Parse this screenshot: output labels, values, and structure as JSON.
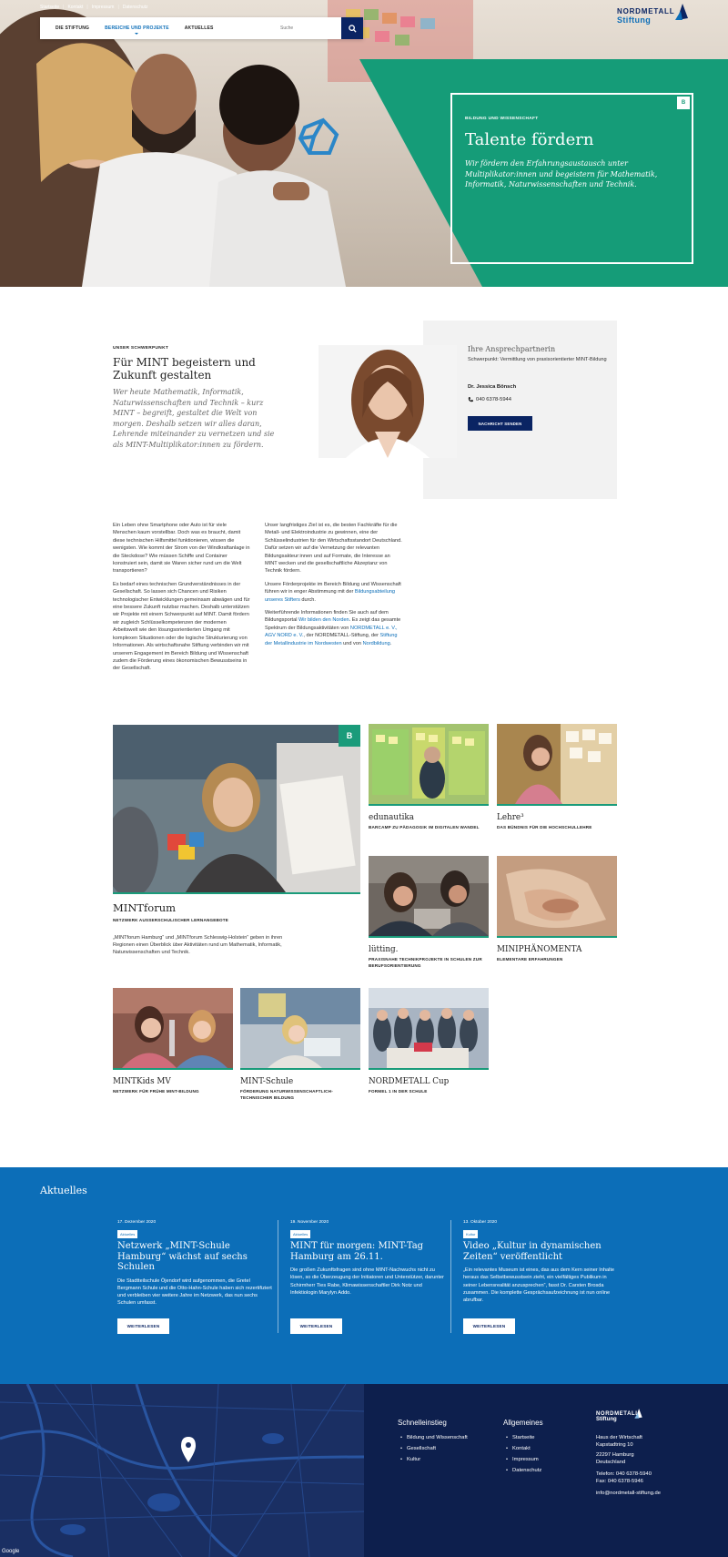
{
  "topmeta": {
    "items": [
      "Startseite",
      "Kontakt",
      "Impressum",
      "Datenschutz"
    ]
  },
  "nav": {
    "items": [
      {
        "label": "DIE STIFTUNG"
      },
      {
        "label": "BEREICHE UND PROJEKTE"
      },
      {
        "label": "AKTUELLES"
      }
    ],
    "active_index": 1,
    "search_placeholder": "Suche"
  },
  "logo": {
    "line1": "NORDMETALL",
    "line2": "Stiftung"
  },
  "hero": {
    "kicker": "BILDUNG UND WISSENSCHAFT",
    "badge": "B",
    "title": "Talente fördern",
    "text": "Wir fördern den Erfahrungsaustausch unter Multiplikator:innen und begeistern für Mathematik, Informatik, Naturwissenschaften und Technik."
  },
  "focus": {
    "kicker": "UNSER SCHWERPUNKT",
    "title": "Für MINT begeistern und Zukunft gestalten",
    "lead": "Wer heute Mathematik, Informatik, Naturwissenschaften und Technik – kurz MINT – begreift, gestaltet die Welt von morgen. Deshalb setzen wir alles daran, Lehrende miteinander zu vernetzen und sie als MINT-Multiplikator:innen zu fördern."
  },
  "contact": {
    "heading": "Ihre Ansprechpartnerin",
    "role": "Schwerpunkt: Vermittlung von praxisorientierter MINT-Bildung",
    "name": "Dr. Jessica Bönsch",
    "phone": "040 6378-5944",
    "button": "NACHRICHT SENDEN"
  },
  "body": {
    "col1": {
      "p1": "Ein Leben ohne Smartphone oder Auto ist für viele Menschen kaum vorstellbar. Doch was es braucht, damit diese technischen Hilfsmittel funktionieren, wissen die wenigsten. Wie kommt der Strom von der Windkraftanlage in die Steckdose? Wie müssen Schiffe und Container konstruiert sein, damit sie Waren sicher rund um die Welt transportieren?",
      "p2": "Es bedarf eines technischen Grundverständnisses in der Gesellschaft. So lassen sich Chancen und Risiken technologischer Entwicklungen gemeinsam abwägen und für eine bessere Zukunft nutzbar machen. Deshalb unterstützen wir Projekte mit einem Schwerpunkt auf MINT. Damit fördern wir zugleich Schlüsselkompetenzen der modernen Arbeitswelt wie den lösungsorientierten Umgang mit komplexen Situationen oder die logische Strukturierung von Informationen. Als wirtschaftsnahe Stiftung verbinden wir mit unserem Engagement im Bereich Bildung und Wissenschaft zudem die Förderung eines ökonomischen Bewusstseins in der Gesellschaft."
    },
    "col2": {
      "p1": "Unser langfristiges Ziel ist es, die besten Fachkräfte für die Metall- und Elektroindustrie zu gewinnen, eine der Schlüsselindustrien für den Wirtschaftsstandort Deutschland. Dafür setzen wir auf die Vernetzung der relevanten Bildungsakteur:innen und auf Formate, die Interesse an MINT wecken und die gesellschaftliche Akzeptanz von Technik fördern.",
      "p2_a": "Unsere Förderprojekte im Bereich Bildung und Wissenschaft führen wir in enger Abstimmung mit der ",
      "p2_link": "Bildungsabteilung unseres Stifters",
      "p2_b": " durch.",
      "p3_a": "Weiterführende Informationen finden Sie auch auf dem Bildungsportal ",
      "p3_link1": "Wir bilden den Norden",
      "p3_b": ". Es zeigt das gesamte Spektrum der Bildungsaktivitäten von ",
      "p3_link2": "NORDMETALL e. V., AGV NORD e. V.",
      "p3_c": ", der NORDMETALL-Stiftung, der ",
      "p3_link3": "Stiftung der Metallindustrie im Nordwesten",
      "p3_d": " und von ",
      "p3_link4": "Nordbildung",
      "p3_e": "."
    }
  },
  "tiles": {
    "badge": "B",
    "mintforum": {
      "title": "MINTforum",
      "sub": "NETZWERK AUSSERSCHULISCHER LERNANGEBOTE",
      "desc": "„MINTforum Hamburg“ und „MINTforum Schleswig-Holstein“ geben in ihren Regionen einen Überblick über Aktivitäten rund um Mathematik, Informatik, Naturwissenschaften und Technik."
    },
    "edunautika": {
      "title": "edunautika",
      "sub": "BARCAMP ZU PÄDAGOGIK IM DIGITALEN WANDEL"
    },
    "lehre": {
      "title": "Lehre³",
      "sub": "DAS BÜNDNIS FÜR DIE HOCHSCHULLEHRE"
    },
    "luetting": {
      "title": "lütting.",
      "sub": "PRAXISNAHE TECHNIKPROJEKTE IN SCHULEN ZUR BERUFSORIENTIERUNG"
    },
    "miniphaenomenta": {
      "title": "MINIPHÄNOMENTA",
      "sub": "ELEMENTARE ERFAHRUNGEN"
    },
    "mintkids": {
      "title": "MINTKids MV",
      "sub": "NETZWERK FÜR FRÜHE MINT-BILDUNG"
    },
    "mintschule": {
      "title": "MINT-Schule",
      "sub": "FÖRDERUNG NATURWISSENSCHAFTLICH-TECHNISCHER BILDUNG"
    },
    "cup": {
      "title": "NORDMETALL Cup",
      "sub": "FORMEL 1 IN DER SCHULE"
    }
  },
  "news": {
    "heading": "Aktuelles",
    "items": [
      {
        "date": "17. Dezember 2020",
        "tag": "Aktuelles",
        "title": "Netzwerk „MINT-Schule Hamburg“ wächst auf sechs Schulen",
        "text": "Die Stadtteilschule Öjendorf wird aufgenommen, die Gretel Bergmann Schule und die Otto-Hahn-Schule haben sich rezertifiziert und verbleiben vier weitere Jahre im Netzwerk, das nun sechs Schulen umfasst.",
        "button": "WEITERLESEN"
      },
      {
        "date": "19. November 2020",
        "tag": "Aktuelles",
        "title": "MINT für morgen: MINT-Tag Hamburg am 26.11.",
        "text": "Die großen Zukunftsfragen sind ohne MINT-Nachwuchs nicht zu lösen, so die Überzeugung der Initiatoren und Unterstützer, darunter Schirmherr Ties Rabe, Klimawissenschaftler Dirk Notz und Infektiologin Marylyn Addo.",
        "button": "WEITERLESEN"
      },
      {
        "date": "13. Oktober 2020",
        "tag": "Kultur",
        "title": "Video „Kultur in dynamischen Zeiten“ veröffentlicht",
        "text": "„Ein relevantes Museum ist eines, das aus dem Kern seiner Inhalte heraus das Selbstbewusstsein zieht, ein vielfältiges Publikum in seiner Lebensrealität anzusprechen“, fasst Dr. Carsten Brosda zusammen. Die komplette Gesprächsaufzeichnung ist nun online abrufbar.",
        "button": "WEITERLESEN"
      }
    ]
  },
  "footer": {
    "quick": {
      "heading": "Schnelleinstieg",
      "items": [
        "Bildung und Wissenschaft",
        "Gesellschaft",
        "Kultur"
      ]
    },
    "general": {
      "heading": "Allgemeines",
      "items": [
        "Startseite",
        "Kontakt",
        "Impressum",
        "Datenschutz"
      ]
    },
    "address": {
      "line1": "Haus der Wirtschaft",
      "line2": "Kapstadtring 10",
      "line3": "22297 Hamburg",
      "line4": "Deutschland",
      "phone": "Telefon: 040 6378-5940",
      "fax": "Fax: 040 6378-5946",
      "email": "info@nordmetall-stiftung.de"
    },
    "google": "Google"
  },
  "colors": {
    "teal": "#1a9b7a",
    "blue": "#0c6eb8",
    "navy": "#0a2463",
    "footer": "#0d1f4d"
  }
}
